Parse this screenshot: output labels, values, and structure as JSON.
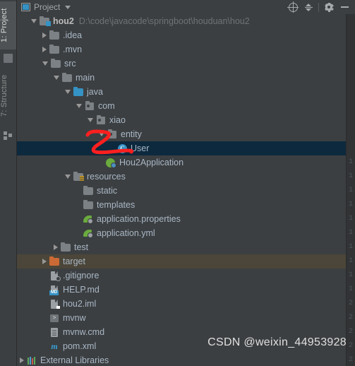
{
  "window": {
    "tool_tabs": [
      {
        "label": "1: Project",
        "icon": "project-square-icon",
        "active": true
      },
      {
        "label": "7: Structure",
        "icon": "structure-blocks-icon",
        "active": false
      }
    ]
  },
  "toolbar": {
    "title": "Project",
    "title_icon": "project-view-icon",
    "dropdown_icon": "chevron-down-icon",
    "buttons": [
      {
        "name": "locate-button",
        "icon": "crosshair-locate-icon",
        "label": ""
      },
      {
        "name": "collapse-all-button",
        "icon": "collapse-all-icon",
        "label": ""
      },
      {
        "name": "settings-button",
        "icon": "gear-icon",
        "label": ""
      },
      {
        "name": "hide-button",
        "icon": "minimize-icon",
        "label": ""
      }
    ]
  },
  "tree": {
    "rows": [
      {
        "label": "hou2",
        "path": "D:\\code\\javacode\\springboot\\houduan\\hou2",
        "indent": 0,
        "arrow": "open",
        "icon": "module-folder-icon",
        "bold": true,
        "state": "normal"
      },
      {
        "label": ".idea",
        "path": "",
        "indent": 1,
        "arrow": "closed",
        "icon": "folder-icon",
        "bold": false,
        "state": "normal"
      },
      {
        "label": ".mvn",
        "path": "",
        "indent": 1,
        "arrow": "closed",
        "icon": "folder-icon",
        "bold": false,
        "state": "normal"
      },
      {
        "label": "src",
        "path": "",
        "indent": 1,
        "arrow": "open",
        "icon": "folder-icon",
        "bold": false,
        "state": "normal"
      },
      {
        "label": "main",
        "path": "",
        "indent": 2,
        "arrow": "open",
        "icon": "folder-icon",
        "bold": false,
        "state": "normal"
      },
      {
        "label": "java",
        "path": "",
        "indent": 3,
        "arrow": "open",
        "icon": "source-root-folder-icon",
        "bold": false,
        "state": "normal"
      },
      {
        "label": "com",
        "path": "",
        "indent": 4,
        "arrow": "open",
        "icon": "package-icon",
        "bold": false,
        "state": "normal"
      },
      {
        "label": "xiao",
        "path": "",
        "indent": 5,
        "arrow": "open",
        "icon": "package-icon",
        "bold": false,
        "state": "normal"
      },
      {
        "label": "entity",
        "path": "",
        "indent": 6,
        "arrow": "open",
        "icon": "package-icon",
        "bold": false,
        "state": "normal"
      },
      {
        "label": "User",
        "path": "",
        "indent": 7,
        "arrow": "none",
        "icon": "java-class-icon",
        "bold": false,
        "state": "selected"
      },
      {
        "label": "Hou2Application",
        "path": "",
        "indent": 6,
        "arrow": "none",
        "icon": "spring-boot-app-icon",
        "bold": false,
        "state": "normal"
      },
      {
        "label": "resources",
        "path": "",
        "indent": 3,
        "arrow": "open",
        "icon": "resources-folder-icon",
        "bold": false,
        "state": "normal"
      },
      {
        "label": "static",
        "path": "",
        "indent": 4,
        "arrow": "none",
        "icon": "folder-icon",
        "bold": false,
        "state": "normal"
      },
      {
        "label": "templates",
        "path": "",
        "indent": 4,
        "arrow": "none",
        "icon": "folder-icon",
        "bold": false,
        "state": "normal"
      },
      {
        "label": "application.properties",
        "path": "",
        "indent": 4,
        "arrow": "none",
        "icon": "spring-config-file-icon",
        "bold": false,
        "state": "normal"
      },
      {
        "label": "application.yml",
        "path": "",
        "indent": 4,
        "arrow": "none",
        "icon": "spring-config-file-icon",
        "bold": false,
        "state": "normal"
      },
      {
        "label": "test",
        "path": "",
        "indent": 2,
        "arrow": "closed",
        "icon": "folder-icon",
        "bold": false,
        "state": "normal"
      },
      {
        "label": "target",
        "path": "",
        "indent": 1,
        "arrow": "closed",
        "icon": "target-folder-icon",
        "bold": false,
        "state": "hovered"
      },
      {
        "label": ".gitignore",
        "path": "",
        "indent": 1,
        "arrow": "none",
        "icon": "gitignore-file-icon",
        "bold": false,
        "state": "normal"
      },
      {
        "label": "HELP.md",
        "path": "",
        "indent": 1,
        "arrow": "none",
        "icon": "markdown-file-icon",
        "bold": false,
        "state": "normal"
      },
      {
        "label": "hou2.iml",
        "path": "",
        "indent": 1,
        "arrow": "none",
        "icon": "iml-file-icon",
        "bold": false,
        "state": "normal"
      },
      {
        "label": "mvnw",
        "path": "",
        "indent": 1,
        "arrow": "none",
        "icon": "shell-script-icon",
        "bold": false,
        "state": "normal"
      },
      {
        "label": "mvnw.cmd",
        "path": "",
        "indent": 1,
        "arrow": "none",
        "icon": "cmd-script-icon",
        "bold": false,
        "state": "normal"
      },
      {
        "label": "pom.xml",
        "path": "",
        "indent": 1,
        "arrow": "none",
        "icon": "maven-pom-icon",
        "bold": false,
        "state": "normal"
      },
      {
        "label": "External Libraries",
        "path": "",
        "indent": -1,
        "arrow": "closed",
        "icon": "libraries-icon",
        "bold": false,
        "state": "normal"
      }
    ]
  },
  "markdown_badge_text": "MD",
  "shell_icon_text": ">",
  "class_icon_letter": "C",
  "maven_icon_letter": "m",
  "annotation": {
    "type": "hand-drawn-arrow",
    "color": "#fb1f1f",
    "points_to": "User"
  },
  "watermark": {
    "text": "CSDN @weixin_44953928"
  },
  "gutter": {
    "line_numbers": [
      "1",
      "1",
      "1",
      "1",
      "1",
      "1",
      "1",
      "1",
      "1",
      "1",
      "2",
      "2",
      "2",
      "2",
      "2"
    ]
  },
  "colors": {
    "background": "#3c3f41",
    "selection": "#0d293e",
    "hover": "#4b4639",
    "text": "#a9b7c6",
    "path_text": "#6e7376",
    "accent_blue": "#3592c4",
    "accent_orange": "#cc6a35",
    "accent_green": "#6aab3e",
    "annotation_red": "#fb1f1f"
  }
}
